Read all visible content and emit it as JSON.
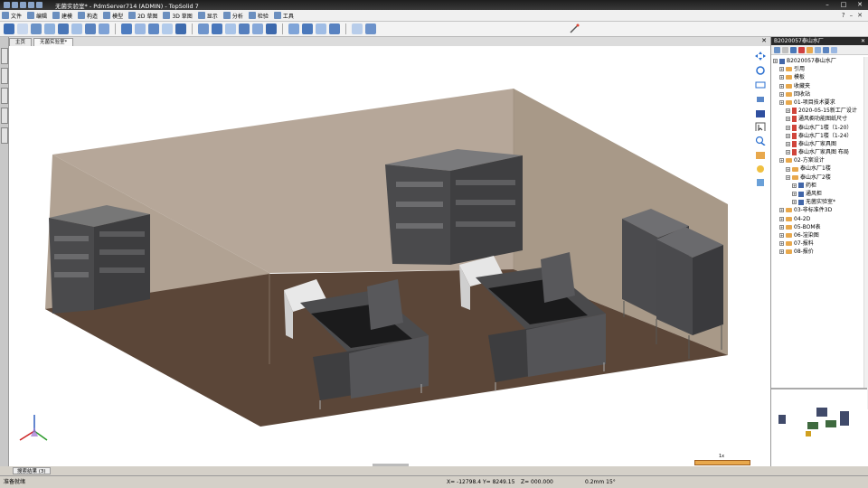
{
  "window": {
    "title": "无菌实验室* - PdmServer714 (ADMIN) - TopSolid 7"
  },
  "menu": {
    "items": [
      "文件",
      "编辑",
      "建模",
      "构造",
      "模型",
      "2D 草图",
      "3D 草图",
      "显示",
      "分析",
      "检验",
      "工具"
    ]
  },
  "tabs": {
    "items": [
      "主页",
      "无菌实验室*"
    ]
  },
  "panel": {
    "header": "B2020057泰山水厂",
    "tree": [
      {
        "label": "B2020057泰山水厂",
        "indent": 0,
        "kind": "asm"
      },
      {
        "label": "引用",
        "indent": 1,
        "kind": "folder"
      },
      {
        "label": "模板",
        "indent": 1,
        "kind": "folder"
      },
      {
        "label": "收藏夹",
        "indent": 1,
        "kind": "folder"
      },
      {
        "label": "回收站",
        "indent": 1,
        "kind": "folder"
      },
      {
        "label": "01-项目技术要求",
        "indent": 1,
        "kind": "folder"
      },
      {
        "label": "2020-05-15新工厂设计",
        "indent": 2,
        "kind": "doc"
      },
      {
        "label": "通风橱功能图纸尺寸",
        "indent": 2,
        "kind": "doc"
      },
      {
        "label": "泰山水厂1楼（1-20）",
        "indent": 2,
        "kind": "doc"
      },
      {
        "label": "泰山水厂1楼（1-24）",
        "indent": 2,
        "kind": "doc"
      },
      {
        "label": "泰山水厂家具图",
        "indent": 2,
        "kind": "doc"
      },
      {
        "label": "泰山水厂家具图 布局",
        "indent": 2,
        "kind": "doc"
      },
      {
        "label": "02-方案设计",
        "indent": 1,
        "kind": "folder"
      },
      {
        "label": "泰山水厂1楼",
        "indent": 2,
        "kind": "folder"
      },
      {
        "label": "泰山水厂2楼",
        "indent": 2,
        "kind": "folder"
      },
      {
        "label": "药柜",
        "indent": 3,
        "kind": "asm"
      },
      {
        "label": "通风柜",
        "indent": 3,
        "kind": "asm"
      },
      {
        "label": "无菌实验室*",
        "indent": 3,
        "kind": "asm"
      },
      {
        "label": "03-非标准件3D",
        "indent": 1,
        "kind": "folder"
      },
      {
        "label": "04-2D",
        "indent": 1,
        "kind": "folder"
      },
      {
        "label": "05-BOM表",
        "indent": 1,
        "kind": "folder"
      },
      {
        "label": "06-渲染图",
        "indent": 1,
        "kind": "folder"
      },
      {
        "label": "07-报料",
        "indent": 1,
        "kind": "folder"
      },
      {
        "label": "08-报价",
        "indent": 1,
        "kind": "folder"
      }
    ]
  },
  "bottom": {
    "tab": "搜索结果 (3)",
    "scale_label": "1x"
  },
  "status": {
    "left": "准备就绪",
    "x": "X= -12798.4",
    "y": "Y= 8249.15",
    "z": "Z= 000.000",
    "tolerance": "0.2mm 15°"
  },
  "colors": {
    "floor": "#5b4638",
    "wall": "#b6a799",
    "wall_dark": "#a39486",
    "cabinet": "#555558",
    "accent_orange": "#e8a84c",
    "tree_folder": "#e8a84c"
  }
}
